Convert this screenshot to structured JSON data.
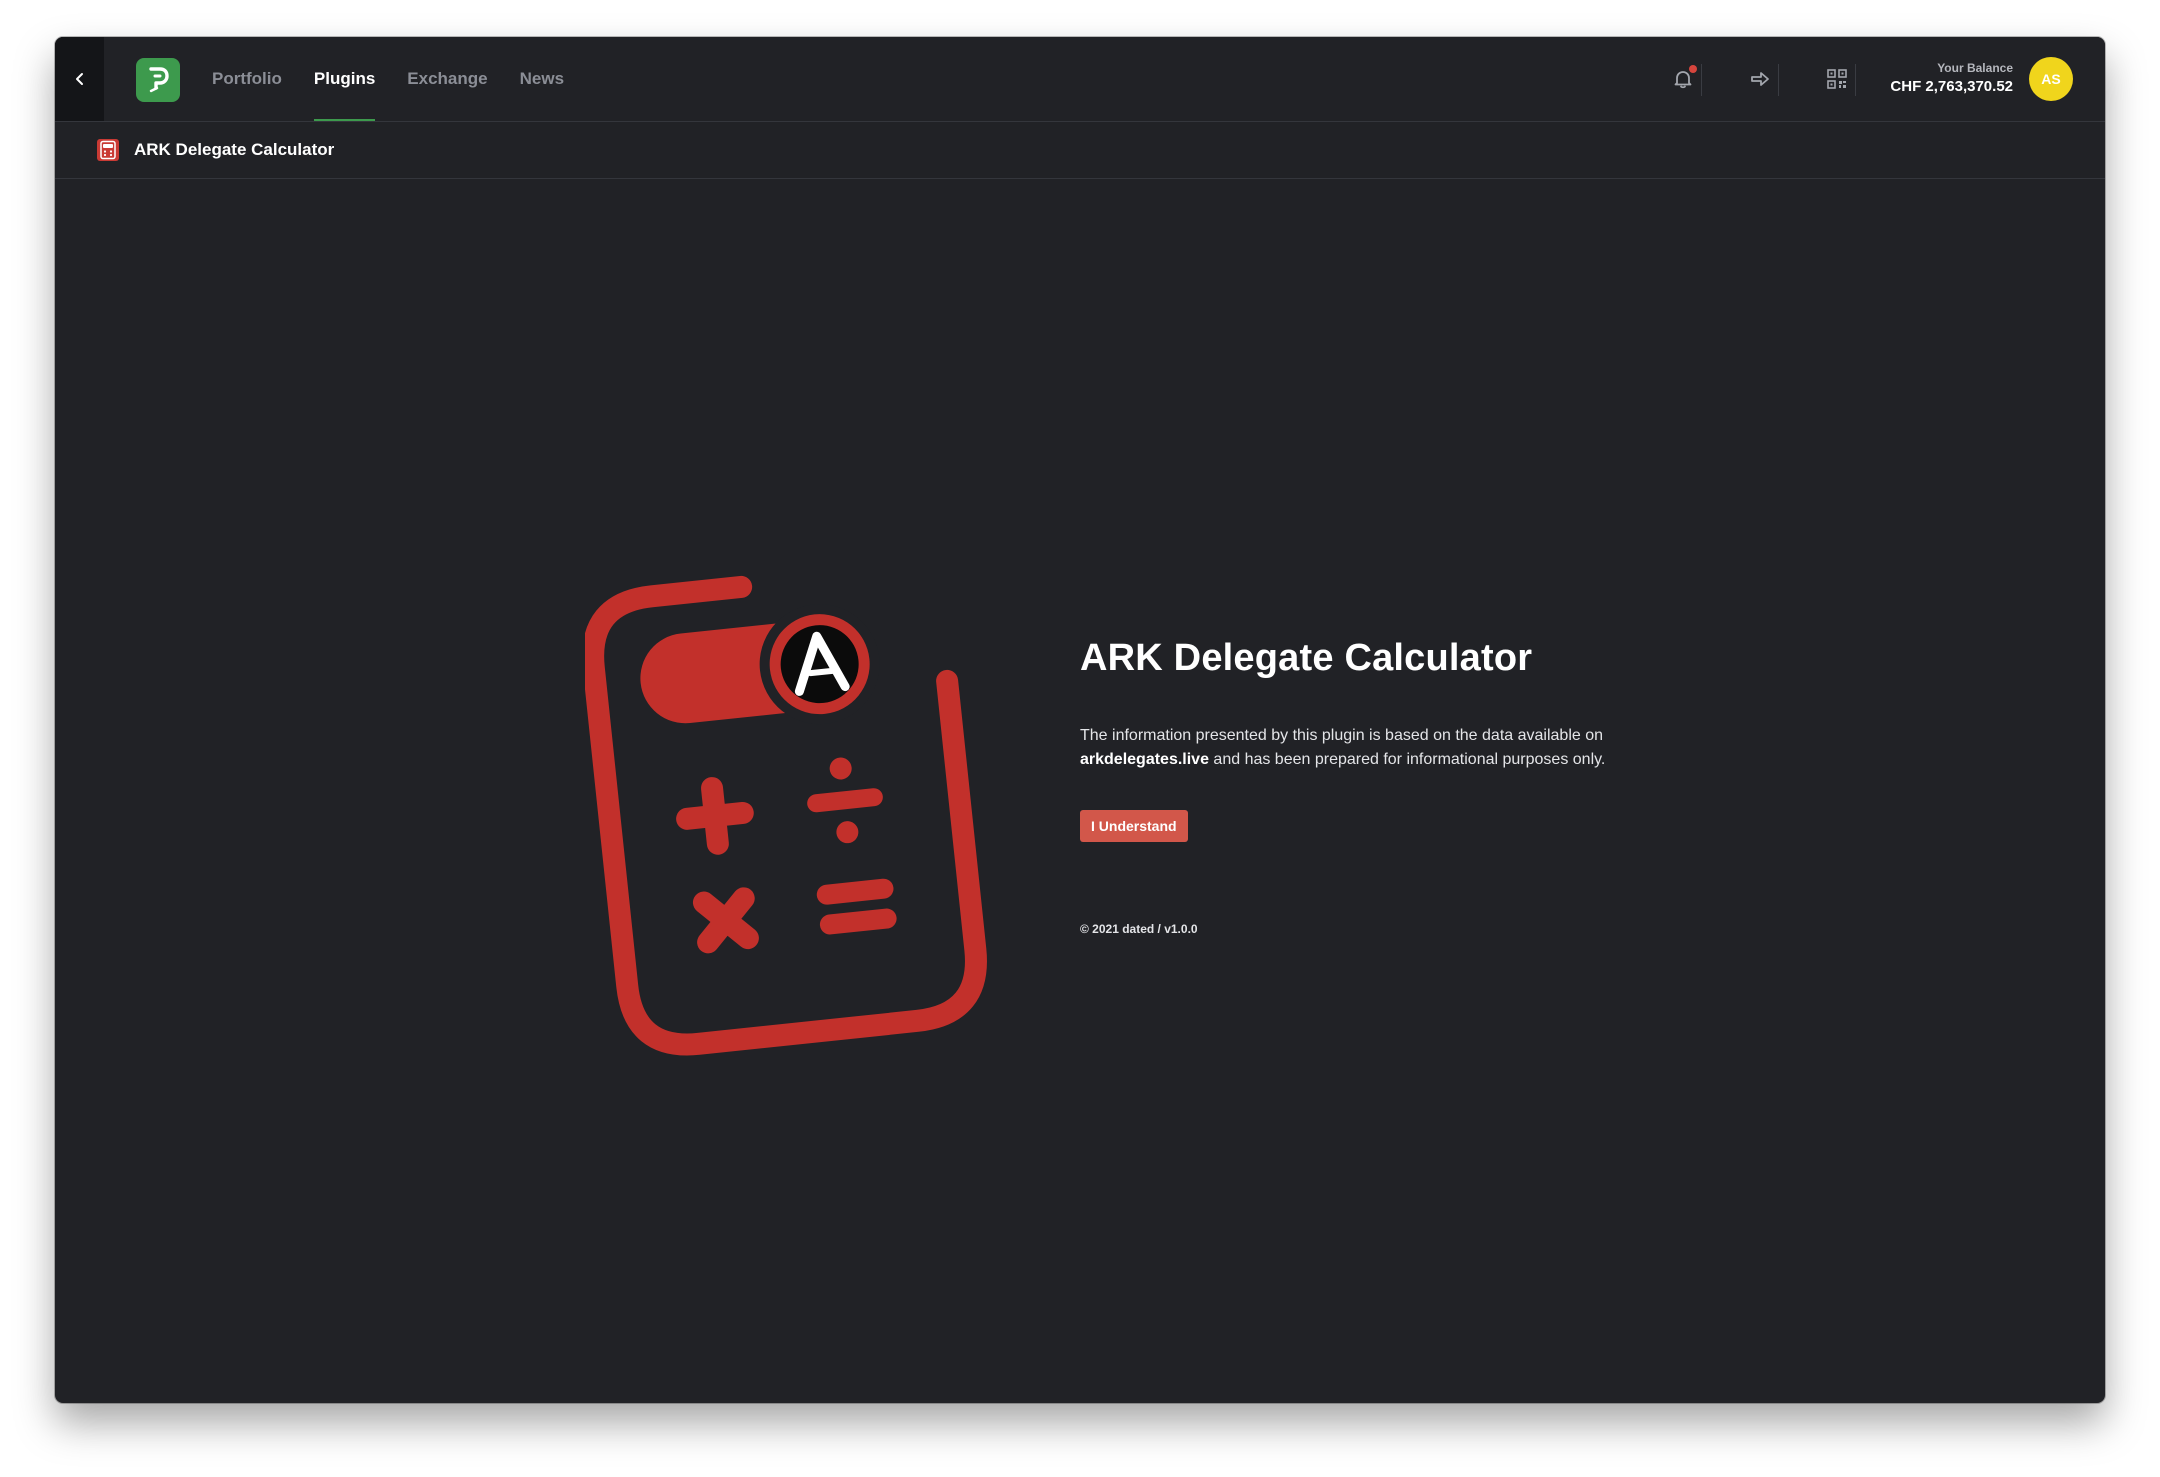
{
  "nav": {
    "items": [
      {
        "label": "Portfolio",
        "active": false
      },
      {
        "label": "Plugins",
        "active": true
      },
      {
        "label": "Exchange",
        "active": false
      },
      {
        "label": "News",
        "active": false
      }
    ]
  },
  "header": {
    "icons": [
      "chevron-left-icon",
      "bell-icon",
      "send-arrow-icon",
      "qr-code-icon"
    ],
    "balance_label": "Your Balance",
    "balance_value": "CHF 2,763,370.52",
    "avatar_initials": "AS"
  },
  "subheader": {
    "plugin_title": "ARK Delegate Calculator"
  },
  "main": {
    "title": "ARK Delegate Calculator",
    "description_prefix": "The information presented by this plugin is based on the data available on",
    "description_link": "arkdelegates.live",
    "description_suffix": "and has been prepared for informational purposes only.",
    "button_label": "I Understand",
    "footer": "© 2021 dated / v1.0.0"
  },
  "colors": {
    "background": "#212226",
    "accent_green": "#3d9a4d",
    "accent_red": "#d2574a",
    "avatar_yellow": "#f0d51c"
  }
}
